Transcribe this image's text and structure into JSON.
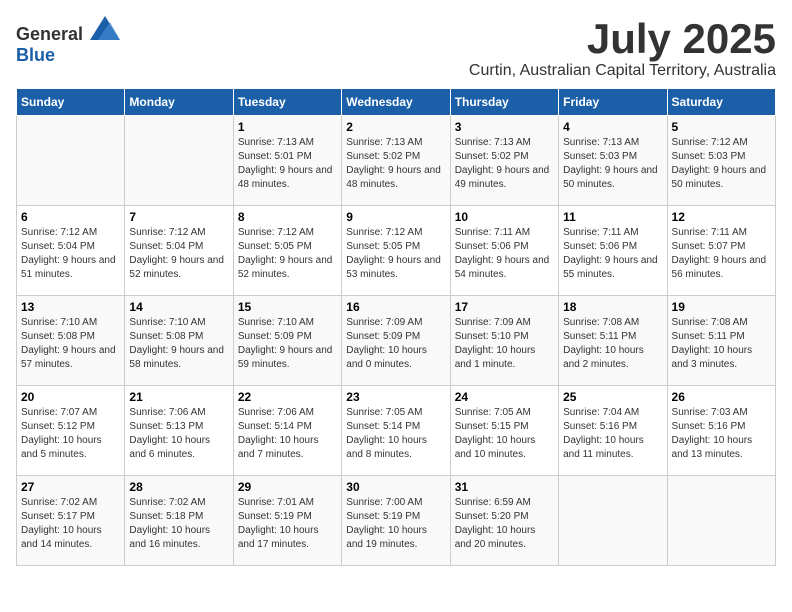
{
  "header": {
    "logo_general": "General",
    "logo_blue": "Blue",
    "month_title": "July 2025",
    "location": "Curtin, Australian Capital Territory, Australia"
  },
  "weekdays": [
    "Sunday",
    "Monday",
    "Tuesday",
    "Wednesday",
    "Thursday",
    "Friday",
    "Saturday"
  ],
  "weeks": [
    [
      {
        "day": "",
        "info": ""
      },
      {
        "day": "",
        "info": ""
      },
      {
        "day": "1",
        "info": "Sunrise: 7:13 AM\nSunset: 5:01 PM\nDaylight: 9 hours and 48 minutes."
      },
      {
        "day": "2",
        "info": "Sunrise: 7:13 AM\nSunset: 5:02 PM\nDaylight: 9 hours and 48 minutes."
      },
      {
        "day": "3",
        "info": "Sunrise: 7:13 AM\nSunset: 5:02 PM\nDaylight: 9 hours and 49 minutes."
      },
      {
        "day": "4",
        "info": "Sunrise: 7:13 AM\nSunset: 5:03 PM\nDaylight: 9 hours and 50 minutes."
      },
      {
        "day": "5",
        "info": "Sunrise: 7:12 AM\nSunset: 5:03 PM\nDaylight: 9 hours and 50 minutes."
      }
    ],
    [
      {
        "day": "6",
        "info": "Sunrise: 7:12 AM\nSunset: 5:04 PM\nDaylight: 9 hours and 51 minutes."
      },
      {
        "day": "7",
        "info": "Sunrise: 7:12 AM\nSunset: 5:04 PM\nDaylight: 9 hours and 52 minutes."
      },
      {
        "day": "8",
        "info": "Sunrise: 7:12 AM\nSunset: 5:05 PM\nDaylight: 9 hours and 52 minutes."
      },
      {
        "day": "9",
        "info": "Sunrise: 7:12 AM\nSunset: 5:05 PM\nDaylight: 9 hours and 53 minutes."
      },
      {
        "day": "10",
        "info": "Sunrise: 7:11 AM\nSunset: 5:06 PM\nDaylight: 9 hours and 54 minutes."
      },
      {
        "day": "11",
        "info": "Sunrise: 7:11 AM\nSunset: 5:06 PM\nDaylight: 9 hours and 55 minutes."
      },
      {
        "day": "12",
        "info": "Sunrise: 7:11 AM\nSunset: 5:07 PM\nDaylight: 9 hours and 56 minutes."
      }
    ],
    [
      {
        "day": "13",
        "info": "Sunrise: 7:10 AM\nSunset: 5:08 PM\nDaylight: 9 hours and 57 minutes."
      },
      {
        "day": "14",
        "info": "Sunrise: 7:10 AM\nSunset: 5:08 PM\nDaylight: 9 hours and 58 minutes."
      },
      {
        "day": "15",
        "info": "Sunrise: 7:10 AM\nSunset: 5:09 PM\nDaylight: 9 hours and 59 minutes."
      },
      {
        "day": "16",
        "info": "Sunrise: 7:09 AM\nSunset: 5:09 PM\nDaylight: 10 hours and 0 minutes."
      },
      {
        "day": "17",
        "info": "Sunrise: 7:09 AM\nSunset: 5:10 PM\nDaylight: 10 hours and 1 minute."
      },
      {
        "day": "18",
        "info": "Sunrise: 7:08 AM\nSunset: 5:11 PM\nDaylight: 10 hours and 2 minutes."
      },
      {
        "day": "19",
        "info": "Sunrise: 7:08 AM\nSunset: 5:11 PM\nDaylight: 10 hours and 3 minutes."
      }
    ],
    [
      {
        "day": "20",
        "info": "Sunrise: 7:07 AM\nSunset: 5:12 PM\nDaylight: 10 hours and 5 minutes."
      },
      {
        "day": "21",
        "info": "Sunrise: 7:06 AM\nSunset: 5:13 PM\nDaylight: 10 hours and 6 minutes."
      },
      {
        "day": "22",
        "info": "Sunrise: 7:06 AM\nSunset: 5:14 PM\nDaylight: 10 hours and 7 minutes."
      },
      {
        "day": "23",
        "info": "Sunrise: 7:05 AM\nSunset: 5:14 PM\nDaylight: 10 hours and 8 minutes."
      },
      {
        "day": "24",
        "info": "Sunrise: 7:05 AM\nSunset: 5:15 PM\nDaylight: 10 hours and 10 minutes."
      },
      {
        "day": "25",
        "info": "Sunrise: 7:04 AM\nSunset: 5:16 PM\nDaylight: 10 hours and 11 minutes."
      },
      {
        "day": "26",
        "info": "Sunrise: 7:03 AM\nSunset: 5:16 PM\nDaylight: 10 hours and 13 minutes."
      }
    ],
    [
      {
        "day": "27",
        "info": "Sunrise: 7:02 AM\nSunset: 5:17 PM\nDaylight: 10 hours and 14 minutes."
      },
      {
        "day": "28",
        "info": "Sunrise: 7:02 AM\nSunset: 5:18 PM\nDaylight: 10 hours and 16 minutes."
      },
      {
        "day": "29",
        "info": "Sunrise: 7:01 AM\nSunset: 5:19 PM\nDaylight: 10 hours and 17 minutes."
      },
      {
        "day": "30",
        "info": "Sunrise: 7:00 AM\nSunset: 5:19 PM\nDaylight: 10 hours and 19 minutes."
      },
      {
        "day": "31",
        "info": "Sunrise: 6:59 AM\nSunset: 5:20 PM\nDaylight: 10 hours and 20 minutes."
      },
      {
        "day": "",
        "info": ""
      },
      {
        "day": "",
        "info": ""
      }
    ]
  ]
}
